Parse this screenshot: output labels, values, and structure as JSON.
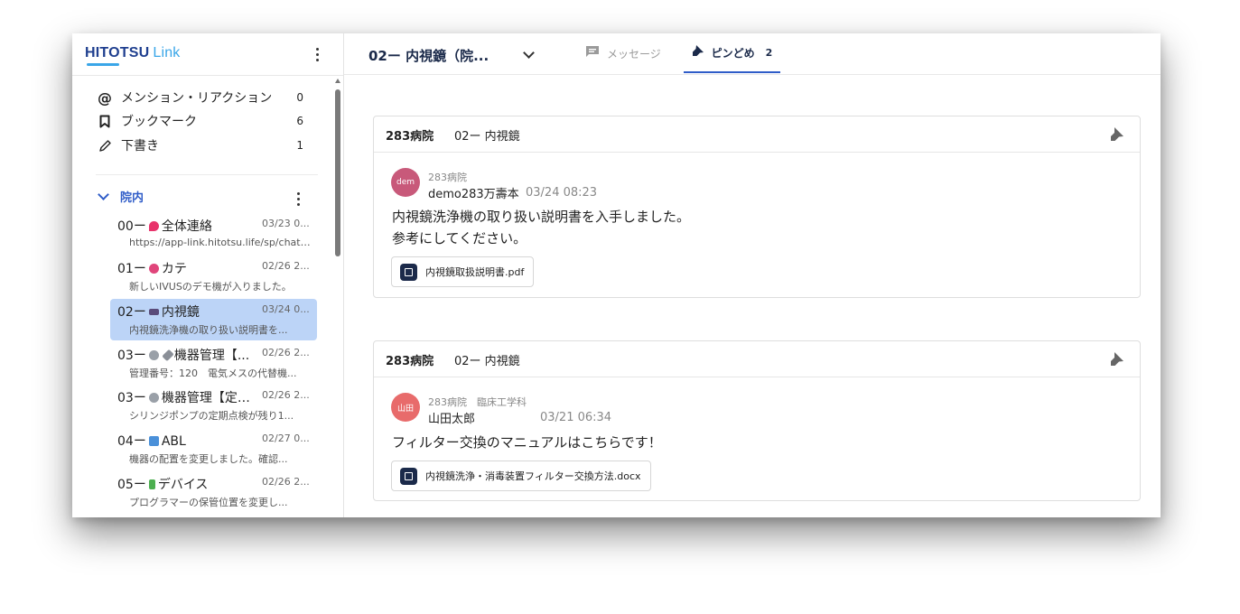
{
  "app": {
    "logo_main": "HITOTSU",
    "logo_sub": "Link"
  },
  "sidebar": {
    "quick_items": [
      {
        "icon": "at-icon",
        "label": "メンション・リアクション",
        "count": "0"
      },
      {
        "icon": "bookmark-icon",
        "label": "ブックマーク",
        "count": "6"
      },
      {
        "icon": "pencil-icon",
        "label": "下書き",
        "count": "1"
      }
    ],
    "group": {
      "label": "院内"
    },
    "rooms": [
      {
        "prefix": "00ー",
        "emoji": "pin-emoji",
        "title": "全体連絡",
        "date": "03/23 0...",
        "preview": "https://app-link.hitotsu.life/sp/chat/1..."
      },
      {
        "prefix": "01ー",
        "emoji": "heart-emoji",
        "title": "カテ",
        "date": "02/26 2...",
        "preview": "新しいIVUSのデモ機が入りました。"
      },
      {
        "prefix": "02ー",
        "emoji": "camera-emoji",
        "title": "内視鏡",
        "date": "03/24 0...",
        "preview": "内視鏡洗浄機の取り扱い説明書を..."
      },
      {
        "prefix": "03ー",
        "emoji": "gear-wrench-emoji",
        "title": "機器管理【...",
        "date": "02/26 2...",
        "preview": "管理番号：120　電気メスの代替機..."
      },
      {
        "prefix": "03ー",
        "emoji": "gear-emoji",
        "title": "機器管理【定期...",
        "date": "02/26 2...",
        "preview": "シリンジポンプの定期点検が残り1..."
      },
      {
        "prefix": "04ー",
        "emoji": "abacus-emoji",
        "title": "ABL",
        "date": "02/27 0...",
        "preview": "機器の配置を変更しました。確認..."
      },
      {
        "prefix": "05ー",
        "emoji": "battery-emoji",
        "title": "デバイス",
        "date": "02/26 2...",
        "preview": "プログラマーの保管位置を変更し..."
      }
    ]
  },
  "header": {
    "room_title": "02ー 内視鏡（院...",
    "tabs": [
      {
        "icon": "message-icon",
        "label": "メッセージ",
        "count": ""
      },
      {
        "icon": "pin-icon",
        "label": "ピンどめ",
        "count": "2"
      }
    ]
  },
  "pinned": [
    {
      "hospital": "283病院",
      "room": "02ー 内視鏡",
      "avatar_text": "dem",
      "avatar_color": "#c8597a",
      "sender_org": "283病院",
      "sender_name": "demo283万壽本",
      "time": "03/24 08:23",
      "body_lines": [
        "内視鏡洗浄機の取り扱い説明書を入手しました。",
        "参考にしてください。"
      ],
      "attachment": "内視鏡取扱説明書.pdf"
    },
    {
      "hospital": "283病院",
      "room": "02ー 内視鏡",
      "avatar_text": "山田",
      "avatar_color": "#e86b6b",
      "sender_org": "283病院　臨床工学科",
      "sender_name": "山田太郎",
      "time": "03/21 06:34",
      "body_lines": [
        "フィルター交換のマニュアルはこちらです！"
      ],
      "attachment": "内視鏡洗浄・消毒装置フィルター交換方法.docx"
    }
  ],
  "colors": {
    "accent": "#2f5cc8",
    "active_room_bg": "#bcd4f7",
    "navy": "#1b2a4a"
  }
}
